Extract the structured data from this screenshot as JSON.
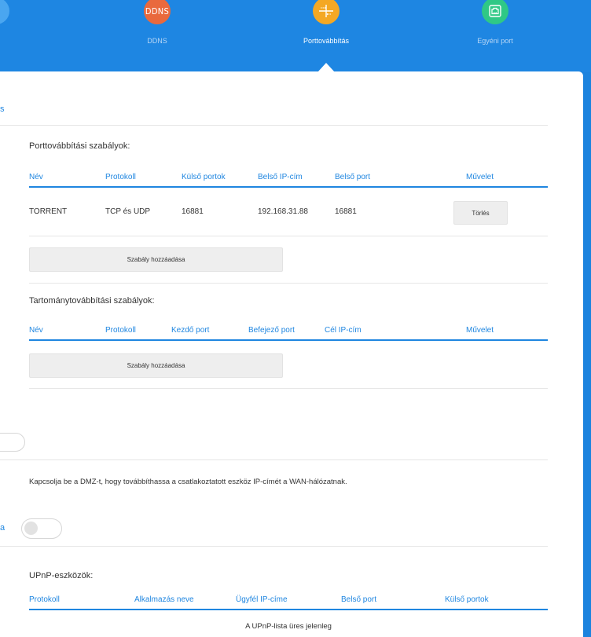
{
  "nav": {
    "items": [
      {
        "label": "DDNS",
        "badge_text": "DDNS",
        "color": "#e9693d",
        "icon": "ddns-icon"
      },
      {
        "label": "Porttovábbítás",
        "color": "#f4a824",
        "icon": "port-forwarding-icon",
        "active": true
      },
      {
        "label": "Egyéni port",
        "color": "#2fc886",
        "icon": "ethernet-port-icon"
      }
    ],
    "partial_left_circle_color": "#4aa6f0"
  },
  "port_forwarding": {
    "header_fragment": "s",
    "rules_title": "Porttovábbítási szabályok:",
    "columns": [
      "Név",
      "Protokoll",
      "Külső portok",
      "Belső IP-cím",
      "Belső port",
      "Művelet"
    ],
    "rows": [
      {
        "name": "TORRENT",
        "protocol": "TCP és UDP",
        "external_ports": "16881",
        "internal_ip": "192.168.31.88",
        "internal_port": "16881",
        "action": "Törlés"
      }
    ],
    "add_rule": "Szabály hozzáadása"
  },
  "range_forwarding": {
    "title": "Tartománytovábbítási szabályok:",
    "columns": [
      "Név",
      "Protokoll",
      "Kezdő port",
      "Befejező port",
      "Cél IP-cím",
      "Művelet"
    ],
    "add_rule": "Szabály hozzáadása"
  },
  "dmz": {
    "description": "Kapcsolja be a DMZ-t, hogy továbbíthassa a csatlakoztatott eszköz IP-címét a WAN-hálózatnak."
  },
  "upnp": {
    "label_fragment": "a",
    "toggle_on": false,
    "devices_title": "UPnP-eszközök:",
    "columns": [
      "Protokoll",
      "Alkalmazás neve",
      "Ügyfél IP-címe",
      "Belső port",
      "Külső portok"
    ],
    "empty_text": "A UPnP-lista üres jelenleg"
  },
  "colors": {
    "primary_blue": "#1f86e0",
    "header_bg": "#1e86e2"
  }
}
